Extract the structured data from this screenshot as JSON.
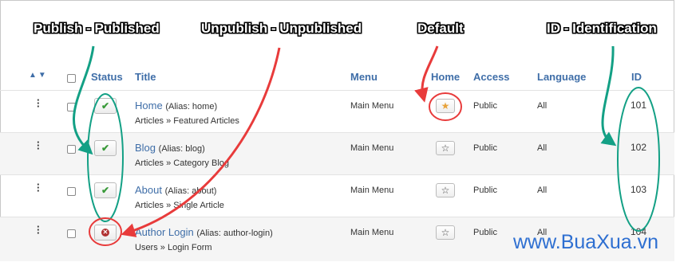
{
  "annotations": {
    "publish": "Publish - Published",
    "unpublish": "Unpublish - Unpublished",
    "default": "Default",
    "id": "ID - Identification"
  },
  "columns": {
    "status": "Status",
    "title": "Title",
    "menu": "Menu",
    "home": "Home",
    "access": "Access",
    "language": "Language",
    "id": "ID"
  },
  "rows": [
    {
      "title": "Home",
      "alias": "(Alias: home)",
      "breadcrumb": "Articles » Featured Articles",
      "menu": "Main Menu",
      "access": "Public",
      "language": "All",
      "id": "101",
      "status": "published",
      "home": "default"
    },
    {
      "title": "Blog",
      "alias": "(Alias: blog)",
      "breadcrumb": "Articles » Category Blog",
      "menu": "Main Menu",
      "access": "Public",
      "language": "All",
      "id": "102",
      "status": "published",
      "home": "not-default"
    },
    {
      "title": "About",
      "alias": "(Alias: about)",
      "breadcrumb": "Articles » Single Article",
      "menu": "Main Menu",
      "access": "Public",
      "language": "All",
      "id": "103",
      "status": "published",
      "home": "not-default"
    },
    {
      "title": "Author Login",
      "alias": "(Alias: author-login)",
      "breadcrumb": "Users » Login Form",
      "menu": "Main Menu",
      "access": "Public",
      "language": "All",
      "id": "104",
      "status": "unpublished",
      "home": "not-default"
    }
  ],
  "watermark": "www.BuaXua.vn",
  "colors": {
    "link": "#3f6ea8",
    "published": "#3a9a3a",
    "unpublished": "#b03030",
    "default_star": "#e8a33b",
    "arrow_green": "#13a085",
    "arrow_red": "#e83b3b",
    "brand": "#2e6fd1"
  }
}
